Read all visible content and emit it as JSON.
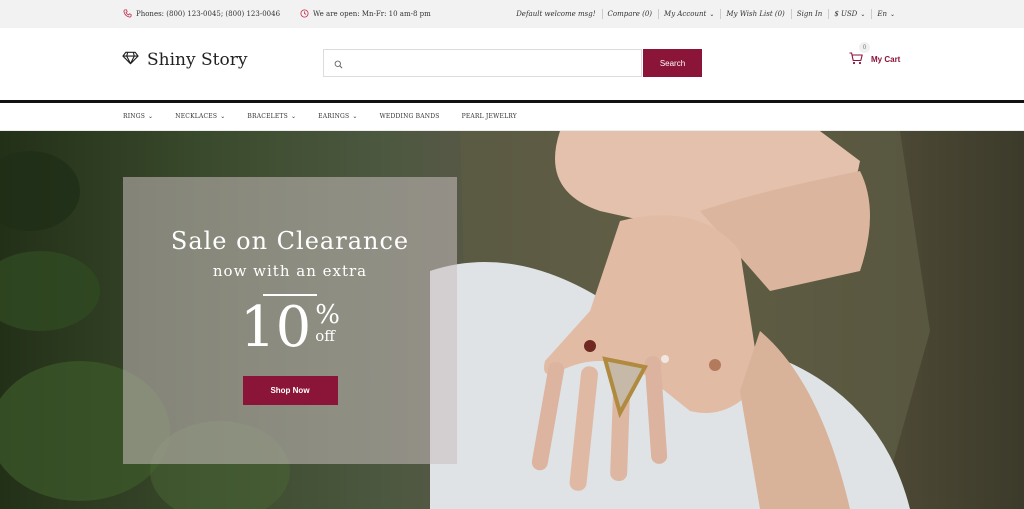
{
  "topbar": {
    "phones": "Phones: (800) 123-0045; (800) 123-0046",
    "hours": "We are open: Mn-Fr: 10 am-8 pm",
    "links": [
      {
        "label": "Default welcome msg!"
      },
      {
        "label": "Compare (0)"
      },
      {
        "label": "My Account",
        "dropdown": true
      },
      {
        "label": "My Wish List (0)"
      },
      {
        "label": "Sign In"
      },
      {
        "label": "$ USD",
        "dropdown": true
      },
      {
        "label": "En",
        "dropdown": true
      }
    ]
  },
  "header": {
    "logo_text": "Shiny Story",
    "search_placeholder": "",
    "search_button": "Search",
    "cart_label": "My Cart",
    "cart_count": "0"
  },
  "nav": {
    "items": [
      {
        "label": "RINGS",
        "dropdown": true
      },
      {
        "label": "NECKLACES",
        "dropdown": true
      },
      {
        "label": "BRACELETS",
        "dropdown": true
      },
      {
        "label": "EARINGS",
        "dropdown": true
      },
      {
        "label": "WEDDING BANDS",
        "dropdown": false
      },
      {
        "label": "PEARL JEWELRY",
        "dropdown": false
      }
    ]
  },
  "hero": {
    "title": "Sale on Clearance",
    "subtitle": "now with an extra",
    "discount": "10",
    "percent_symbol": "%",
    "off_label": "off",
    "button": "Shop Now"
  },
  "colors": {
    "brand": "#8a1538",
    "topbar_bg": "#f2f2f2",
    "header_rule": "#111111"
  },
  "icons": {
    "phone": "phone-icon",
    "clock": "clock-icon",
    "logo": "diamond-icon",
    "search": "search-icon",
    "cart": "cart-icon"
  }
}
